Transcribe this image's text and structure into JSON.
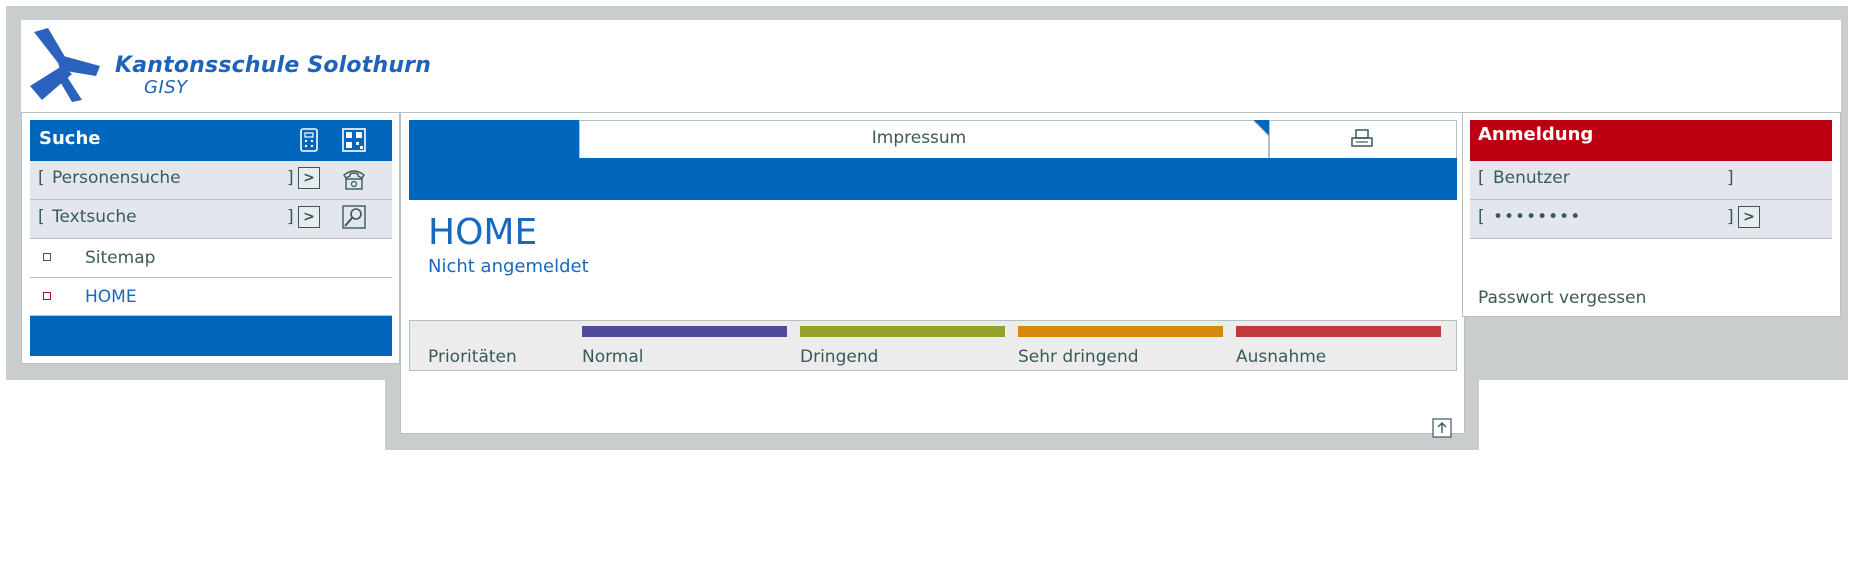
{
  "header": {
    "logo_title": "Kantonsschule Solothurn",
    "logo_subtitle": "GISY",
    "logo_icon": "ks-logo-icon"
  },
  "search": {
    "title": "Suche",
    "header_icons": [
      "keypad-icon",
      "qr-grid-icon"
    ],
    "rows": [
      {
        "label": "Personensuche",
        "open_bracket": "[",
        "close_bracket": "]",
        "go": ">",
        "icon": "phone-icon"
      },
      {
        "label": "Textsuche",
        "open_bracket": "[",
        "close_bracket": "]",
        "go": ">",
        "icon": "zoom-icon"
      }
    ]
  },
  "nav": {
    "items": [
      {
        "label": "Sitemap",
        "bullet_color": "#3a5a5a"
      },
      {
        "label": "HOME",
        "bullet_color": "#b0006a"
      }
    ]
  },
  "center": {
    "tab_label": "Impressum",
    "print_icon": "print-icon",
    "title": "HOME",
    "subtitle": "Nicht angemeldet",
    "priorities_label": "Prioritäten",
    "priorities": [
      {
        "label": "Normal",
        "color": "#4f4b9d"
      },
      {
        "label": "Dringend",
        "color": "#94a22c"
      },
      {
        "label": "Sehr dringend",
        "color": "#d58a0b"
      },
      {
        "label": "Ausnahme",
        "color": "#c1393a"
      }
    ],
    "scroll_top_icon": "arrow-up-icon"
  },
  "login": {
    "title": "Anmeldung",
    "user_label": "Benutzer",
    "password_mask": "••••••••",
    "open_bracket": "[",
    "close_bracket": "]",
    "go": ">",
    "forgot": "Passwort vergessen"
  },
  "colors": {
    "brand_blue": "#0066bc",
    "login_red": "#bd0011",
    "frame_grey": "#c9cdce"
  }
}
